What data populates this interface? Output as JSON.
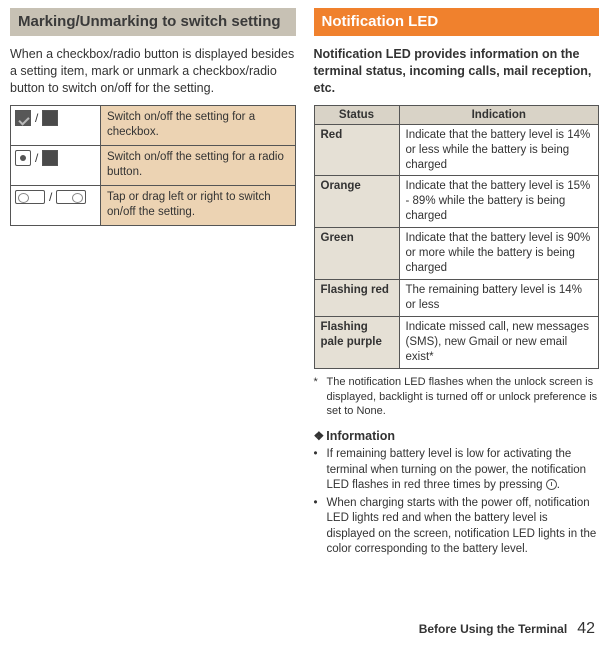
{
  "left": {
    "header": "Marking/Unmarking to switch setting",
    "intro": "When a checkbox/radio button is displayed besides a setting item, mark or unmark a checkbox/radio button to switch on/off for the setting.",
    "rows": [
      {
        "desc": "Switch on/off the setting for a checkbox."
      },
      {
        "desc": "Switch on/off the setting for a radio button."
      },
      {
        "desc": "Tap or drag left or right to switch on/off the setting."
      }
    ]
  },
  "right": {
    "header": "Notification LED",
    "intro": "Notification LED provides information on the terminal status, incoming calls, mail reception, etc.",
    "table": {
      "head_status": "Status",
      "head_indication": "Indication",
      "rows": [
        {
          "status": "Red",
          "indication": "Indicate that the battery level is 14% or less while the battery is being charged"
        },
        {
          "status": "Orange",
          "indication": "Indicate that the battery level is 15% - 89% while the battery is being charged"
        },
        {
          "status": "Green",
          "indication": "Indicate that the battery level is 90% or more while the battery is being charged"
        },
        {
          "status": "Flashing red",
          "indication": "The remaining battery level is 14% or less"
        },
        {
          "status": "Flashing pale purple",
          "indication": "Indicate missed call, new messages (SMS), new Gmail or new email exist*"
        }
      ]
    },
    "footnote_mark": "*",
    "footnote": "The notification LED flashes when the unlock screen is displayed, backlight is turned off or unlock preference is set to None.",
    "info_title": "Information",
    "info_items": [
      "If remaining battery level is low for activating the terminal when turning on the power, the notification LED flashes in red three times by pressing ",
      "When charging starts with the power off, notification LED lights red and when the battery level is displayed on the screen, notification LED lights in the color corresponding to the battery level."
    ],
    "info_item0_tail": "."
  },
  "footer": {
    "label": "Before Using the Terminal",
    "page": "42"
  }
}
